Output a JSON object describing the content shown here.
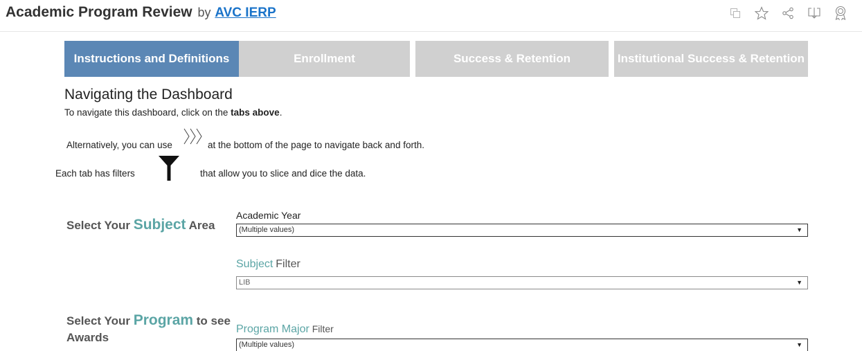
{
  "header": {
    "title": "Academic Program Review",
    "by": "by",
    "author_link": "AVC IERP",
    "icons": [
      "copy-icon",
      "star-icon",
      "share-icon",
      "download-icon",
      "badge-icon"
    ]
  },
  "tabs": [
    {
      "label": "Instructions and Definitions",
      "active": true
    },
    {
      "label": "Enrollment",
      "active": false
    },
    {
      "label": "Success & Retention",
      "active": false
    },
    {
      "label": "Institutional Success & Retention",
      "active": false
    }
  ],
  "instructions": {
    "heading": "Navigating the Dashboard",
    "line1_prefix": "To navigate this dashboard, click on the ",
    "line1_bold": "tabs above",
    "line1_suffix": ".",
    "line2_prefix": "Alternatively, you can use",
    "line2_suffix": "at the bottom of the page to navigate back and forth.",
    "line3_prefix": "Each tab has filters",
    "line3_suffix": "that allow you to slice and dice the data."
  },
  "subject_section": {
    "prefix": "Select Your ",
    "accent": "Subject",
    "suffix": " Area"
  },
  "program_section": {
    "prefix": "Select Your ",
    "accent": "Program",
    "suffix": " to see",
    "line2": "Awards"
  },
  "filters": {
    "academic_year": {
      "label": "Academic Year",
      "value": "(Multiple values)"
    },
    "subject": {
      "accent": "Subject",
      "label": "Filter",
      "value": "LIB"
    },
    "program_major": {
      "accent": "Program Major",
      "label": "Filter",
      "value": "(Multiple values)"
    }
  },
  "colors": {
    "active_tab": "#5b87b5",
    "inactive_tab": "#d0d0d0",
    "accent_teal": "#5ba5a5",
    "link": "#1a73c9"
  }
}
